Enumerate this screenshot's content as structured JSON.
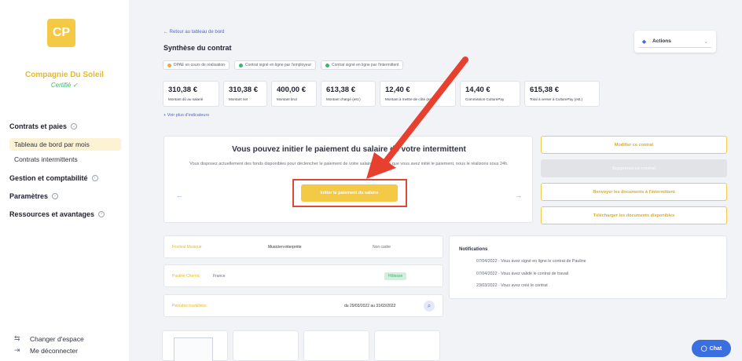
{
  "sidebar": {
    "logo_text": "CP",
    "company_name": "Compagnie Du Soleil",
    "certified": "Certifié ✓",
    "sections": {
      "contracts": "Contrats et paies",
      "dashboard": "Tableau de bord par mois",
      "intermittent": "Contrats intermittents",
      "management": "Gestion et comptabilité",
      "settings": "Paramètres",
      "resources": "Ressources et avantages"
    },
    "bottom": {
      "switch": "Changer d'espace",
      "logout": "Me déconnecter"
    }
  },
  "header": {
    "back": "← Retour au tableau de bord",
    "title": "Synthèse du contrat",
    "actions_label": "Actions"
  },
  "badges": [
    {
      "label": "DPAE en cours de réalisation",
      "color": "#f0a840"
    },
    {
      "label": "Contrat signé en ligne par l'employeur",
      "color": "#3db46d"
    },
    {
      "label": "Contrat signé en ligne par l'intermittent",
      "color": "#3db46d"
    }
  ],
  "kpis": [
    {
      "value": "310,38 €",
      "label": "Montant dû au salarié"
    },
    {
      "value": "310,38 €",
      "label": "Montant net"
    },
    {
      "value": "400,00 €",
      "label": "Montant brut"
    },
    {
      "value": "613,38 €",
      "label": "Montant chargé (est.)"
    },
    {
      "value": "12,40 €",
      "label": "Montant à mettre de côté (est.)"
    },
    {
      "value": "14,40 €",
      "label": "Commission CulturePay"
    },
    {
      "value": "615,38 €",
      "label": "Total à verser à CulturePay (est.)"
    }
  ],
  "more_indicators": "+ Voir plus d'indicateurs",
  "payment": {
    "title": "Vous pouvez initier le paiement du salaire de votre intermittent",
    "description": "Vous disposez actuellement des fonds disponibles pour déclencher le paiement de votre salaire. Dès lors que vous avez initié le paiement, nous le réalisons sous 24h.",
    "button": "Initier le paiement du salaire",
    "prev": "←",
    "next": "→"
  },
  "side_buttons": {
    "modify": "Modifier ce contrat",
    "delete": "Supprimer ce contrat",
    "resend": "Renvoyer les documents à l'intermittent",
    "download": "Télécharger les documents disponibles"
  },
  "info": {
    "festival": "Festival Musique",
    "role": "Musicien-interprète",
    "status": "Non cadre",
    "person": "Pauline Chernic",
    "country": "France",
    "badge": "Hôtesse",
    "period_label": "Périodes travaillées",
    "period": "du 29/03/2022 au 31/03/2022"
  },
  "notifications": {
    "title": "Notifications",
    "items": [
      "07/04/2022 - Vous avez signé en ligne le contrat de Pauline",
      "07/04/2022 - Vous avez validé le contrat de travail",
      "23/03/2022 - Vous avez créé le contrat"
    ]
  },
  "chat_label": "Chat"
}
